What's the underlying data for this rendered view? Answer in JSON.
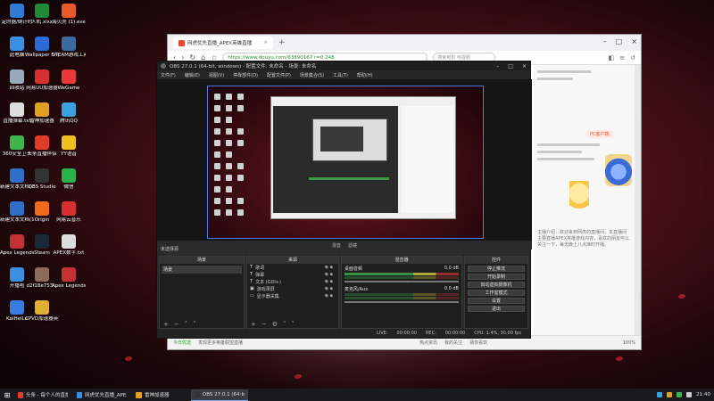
{
  "desktop": {
    "icons": [
      {
        "label": "定时器/倒计时",
        "icon": "timer-icon",
        "color": "#2f7bd6"
      },
      {
        "label": "此电脑",
        "icon": "computer-icon",
        "color": "#3a8fe0"
      },
      {
        "label": "回收站",
        "icon": "recycle-bin-icon",
        "color": "#9ab"
      },
      {
        "label": "直播弹幕.txt",
        "icon": "text-file-icon",
        "color": "#ddd"
      },
      {
        "label": "360安全卫士",
        "icon": "shield-icon",
        "color": "#3fb24a"
      },
      {
        "label": "新建文本文档(2).docx",
        "icon": "word-doc-icon",
        "color": "#2f6ec9"
      },
      {
        "label": "新建文本文档(1).docx",
        "icon": "word-doc-icon",
        "color": "#2f6ec9"
      },
      {
        "label": "Apex Legends",
        "icon": "apex-icon",
        "color": "#c23232"
      },
      {
        "label": "开播啦",
        "icon": "live-icon",
        "color": "#3a8fe0"
      },
      {
        "label": "KaiHeiLa",
        "icon": "kaiheila-icon",
        "color": "#3b7be0"
      },
      {
        "label": "人机.xlsx",
        "icon": "excel-icon",
        "color": "#1e8a3a"
      },
      {
        "label": "Wallpaper Engine",
        "icon": "wallpaper-icon",
        "color": "#2a6bd6"
      },
      {
        "label": "网易UU加速器",
        "icon": "uu-icon",
        "color": "#d63030"
      },
      {
        "label": "雷神加速器",
        "icon": "thunder-icon",
        "color": "#e0a020"
      },
      {
        "label": "头条直播伴侣",
        "icon": "toutiao-icon",
        "color": "#e03a2a"
      },
      {
        "label": "OBS Studio",
        "icon": "obs-icon",
        "color": "#333"
      },
      {
        "label": "Origin",
        "icon": "origin-icon",
        "color": "#f06a1a"
      },
      {
        "label": "Steam",
        "icon": "steam-icon",
        "color": "#1b2838"
      },
      {
        "label": "d2f18e753...",
        "icon": "image-icon",
        "color": "#8a6a5a"
      },
      {
        "label": "CPVD加速器英大版",
        "icon": "cpvd-icon",
        "color": "#e0b030"
      },
      {
        "label": "海贝壳 (1).exe",
        "icon": "app-icon",
        "color": "#e85a2a"
      },
      {
        "label": "STEAM游戏工具",
        "icon": "steam-tool-icon",
        "color": "#3a6aa0"
      },
      {
        "label": "WeGame",
        "icon": "wegame-icon",
        "color": "#e83a3a"
      },
      {
        "label": "腾讯QQ",
        "icon": "qq-icon",
        "color": "#3aa0e0"
      },
      {
        "label": "YY语音",
        "icon": "yy-icon",
        "color": "#f0c020"
      },
      {
        "label": "微信",
        "icon": "wechat-icon",
        "color": "#2ab24a"
      },
      {
        "label": "网易云音乐",
        "icon": "music-icon",
        "color": "#d63030"
      },
      {
        "label": "APEX数字.txt",
        "icon": "text-file-icon",
        "color": "#ddd"
      },
      {
        "label": "Apex Legends",
        "icon": "apex-icon",
        "color": "#c23232"
      }
    ]
  },
  "browser": {
    "tab_title": "网虎优先直播_APEX英雄直播",
    "url": "https://www.douyu.com/63890167 r=0.248",
    "search_placeholder": "搜索电影 电视剧",
    "status_left": "今日优选",
    "status_mid": "发现更多英雄联盟直播",
    "status_items": [
      "热点资讯",
      "我的关注",
      "猜你喜欢"
    ],
    "zoom": "100%",
    "page_badge": "PC客户端",
    "page_text": "主播介绍：欢迎来到网虎的直播间，本直播间主要直播APEX英雄游戏内容，喜欢的朋友可以关注一下，每天晚上八点准时开播。"
  },
  "obs": {
    "title": "OBS 27.0.1 (64-bit, windows) - 配置文件: 未命名 - 场景: 未命名",
    "menu": [
      "文件(F)",
      "编辑(E)",
      "视图(V)",
      "停靠部件(D)",
      "配置文件(P)",
      "场景集合(S)",
      "工具(T)",
      "帮助(H)"
    ],
    "dock_tabs": [
      "混音",
      "滤镜"
    ],
    "scene_label": "未选择源",
    "scenes_header": "场景",
    "scenes": [
      "场景"
    ],
    "sources_header": "来源",
    "sources": [
      {
        "name": "歌词",
        "icon": "text-icon"
      },
      {
        "name": "弹幕",
        "icon": "text-icon"
      },
      {
        "name": "文本 (GDI+)",
        "icon": "text-icon"
      },
      {
        "name": "游戏录屏",
        "icon": "window-capture-icon"
      },
      {
        "name": "显示器采集",
        "icon": "monitor-icon"
      }
    ],
    "mixer_header": "混音器",
    "mixer": [
      {
        "name": "桌面音频",
        "db": "0.0 dB"
      },
      {
        "name": "麦克风/Aux",
        "db": "0.0 dB"
      }
    ],
    "controls_header": "控件",
    "controls": [
      "停止推流",
      "开始录制",
      "启动虚拟摄像机",
      "工作室模式",
      "设置",
      "退出"
    ],
    "status": {
      "live_label": "LIVE:",
      "live_time": "00:00:00",
      "rec_label": "REC:",
      "rec_time": "00:00:00",
      "cpu": "CPU: 1.4%, 30.00 fps"
    }
  },
  "taskbar": {
    "start_icon": "windows-start-icon",
    "items": [
      {
        "label": "头条 - 每个人的直播...",
        "color": "#e03a2a"
      },
      {
        "label": "网虎优先直播_APEX...",
        "color": "#3a8fe0"
      },
      {
        "label": "雷神加速器",
        "color": "#e0a020"
      },
      {
        "label": "OBS 27.0.1 (64-bit...",
        "color": "#333",
        "active": true
      }
    ],
    "time": "21:40"
  }
}
